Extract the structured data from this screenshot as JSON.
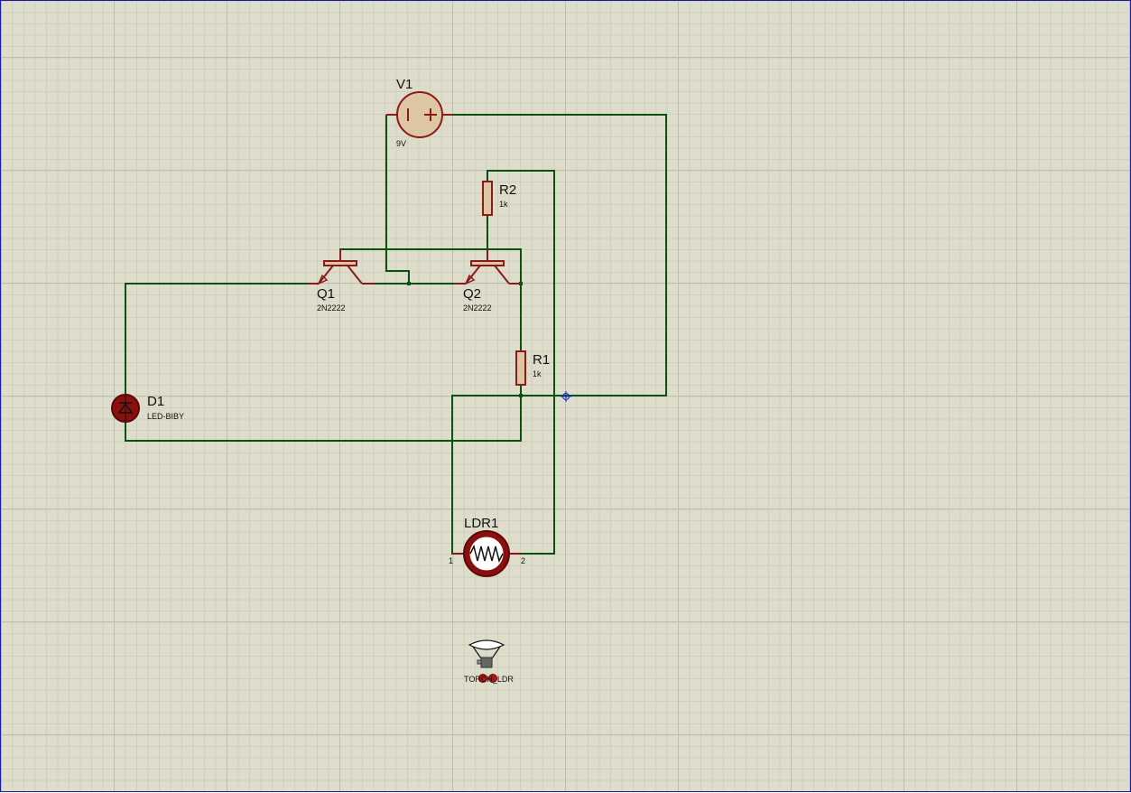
{
  "components": {
    "v1": {
      "ref": "V1",
      "value": "9V"
    },
    "r2": {
      "ref": "R2",
      "value": "1k"
    },
    "r1": {
      "ref": "R1",
      "value": "1k"
    },
    "q1": {
      "ref": "Q1",
      "value": "2N2222"
    },
    "q2": {
      "ref": "Q2",
      "value": "2N2222"
    },
    "d1": {
      "ref": "D1",
      "value": "LED-BIBY"
    },
    "ldr1": {
      "ref": "LDR1",
      "pin1": "1",
      "pin2": "2"
    },
    "torch": {
      "label": "TORCH_LDR"
    }
  },
  "colors": {
    "wire": "#0b5210",
    "component": "#8b1a1a",
    "grid_bg": "#deddcb"
  }
}
